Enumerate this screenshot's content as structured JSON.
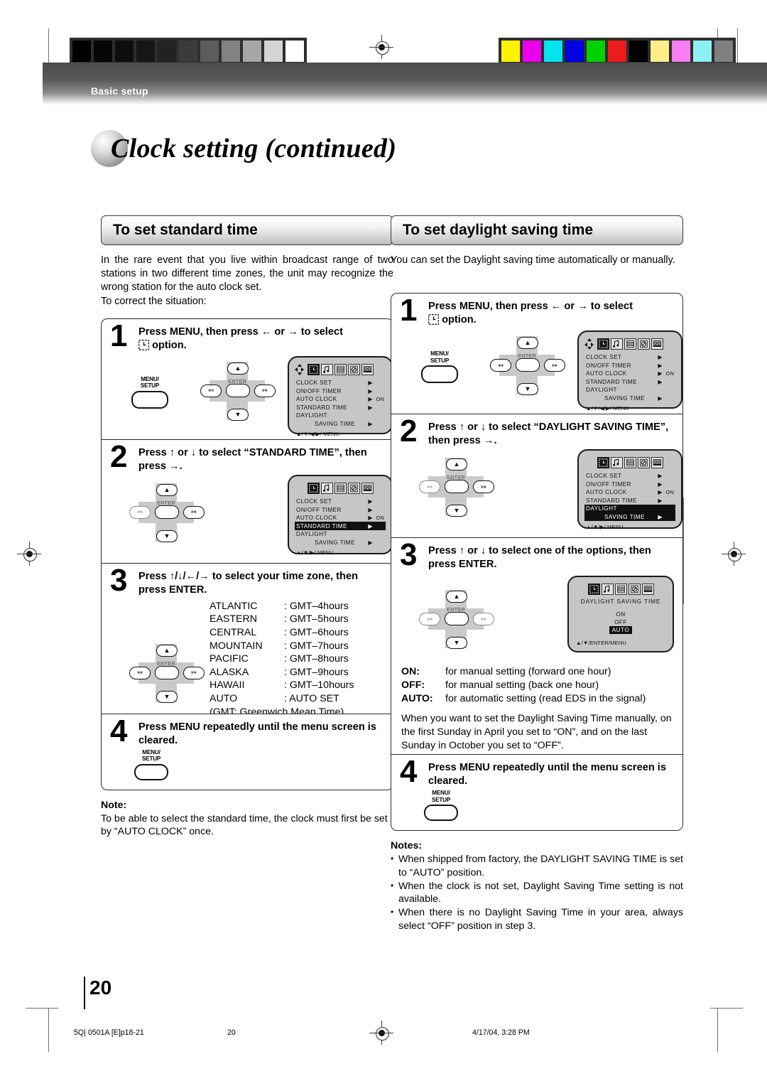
{
  "header": {
    "band_label": "Basic setup"
  },
  "title": {
    "text": "Clock setting (continued)"
  },
  "left_column": {
    "heading": "To set standard time",
    "intro": "In the rare event that you live within broadcast range of two stations in two different time zones, the unit may recognize the wrong station for the auto clock set.",
    "intro2": "To correct the situation:",
    "steps": [
      {
        "num": "1",
        "title_a": "Press MENU, then press",
        "arrow_left": "←",
        "or": "or",
        "arrow_right": "→",
        "title_b": "to select",
        "title_c": "option.",
        "menu_button": "MENU/\nSETUP"
      },
      {
        "num": "2",
        "title": "Press ↑ or ↓ to select “STANDARD TIME”, then press →."
      },
      {
        "num": "3",
        "title": "Press ↑/↓/←/→ to select your time zone, then press ENTER."
      },
      {
        "num": "4",
        "title": "Press MENU repeatedly until the menu screen is cleared.",
        "menu_button": "MENU/\nSETUP"
      }
    ],
    "timezones": [
      {
        "zone": "ATLANTIC",
        "value": ": GMT–4hours"
      },
      {
        "zone": "EASTERN",
        "value": ": GMT–5hours"
      },
      {
        "zone": "CENTRAL",
        "value": ": GMT–6hours"
      },
      {
        "zone": "MOUNTAIN",
        "value": ": GMT–7hours"
      },
      {
        "zone": "PACIFIC",
        "value": ": GMT–8hours"
      },
      {
        "zone": "ALASKA",
        "value": ": GMT–9hours"
      },
      {
        "zone": "HAWAII",
        "value": ": GMT–10hours"
      },
      {
        "zone": "AUTO",
        "value": ": AUTO SET"
      }
    ],
    "gmt_note": "(GMT: Greenwich Mean Time)",
    "note": {
      "heading": "Note:",
      "body": "To be able to select the standard time, the clock must first be set by “AUTO CLOCK” once."
    }
  },
  "right_column": {
    "heading": "To set daylight saving time",
    "intro": "You can set the Daylight saving time automatically or manually.",
    "steps": [
      {
        "num": "1",
        "title_a": "Press MENU, then press",
        "arrow_left": "←",
        "or": "or",
        "arrow_right": "→",
        "title_b": "to select",
        "title_c": "option.",
        "menu_button": "MENU/\nSETUP"
      },
      {
        "num": "2",
        "title": "Press ↑ or ↓ to select “DAYLIGHT SAVING TIME”, then press →."
      },
      {
        "num": "3",
        "title": "Press ↑ or ↓ to select one of the options, then press ENTER."
      },
      {
        "num": "4",
        "title": "Press MENU repeatedly until the menu screen is cleared.",
        "menu_button": "MENU/\nSETUP"
      }
    ],
    "option_defs": [
      {
        "key": "ON:",
        "desc": "for manual setting (forward one hour)"
      },
      {
        "key": "OFF:",
        "desc": "for manual setting (back one hour)"
      },
      {
        "key": "AUTO:",
        "desc": "for automatic setting (read EDS in the signal)"
      }
    ],
    "manual_para": "When you want to set the Daylight Saving Time manually, on the first Sunday in April you set to “ON”, and on the last Sunday in October you set to “OFF”.",
    "notes": {
      "heading": "Notes:",
      "items": [
        "When shipped from factory, the DAYLIGHT SAVING TIME is set to “AUTO” position.",
        "When the clock is not set, Daylight Saving Time setting is not available.",
        "When there is no Daylight Saving Time in your area, always select “OFF” position in step 3."
      ]
    }
  },
  "osd": {
    "menu_items": [
      {
        "label": "CLOCK  SET",
        "arrow": "▶",
        "value": ""
      },
      {
        "label": "ON/OFF  TIMER",
        "arrow": "▶",
        "value": ""
      },
      {
        "label": "AUTO  CLOCK",
        "arrow": "▶",
        "value": "ON"
      },
      {
        "label": "STANDARD  TIME",
        "arrow": "▶",
        "value": ""
      },
      {
        "label": "DAYLIGHT",
        "arrow": "",
        "value": ""
      },
      {
        "label": "SAVING  TIME",
        "arrow": "▶",
        "value": ""
      }
    ],
    "foot_full": "▲/▼/◀/▶/ MENU",
    "foot_short": "▲/▼/▶/ MENU",
    "foot_enter": "▲/▼/ENTER/MENU",
    "dst_title": "DAYLIGHT  SAVING  TIME",
    "dst_options": [
      "ON",
      "OFF",
      "AUTO"
    ],
    "dst_selected": "AUTO",
    "enter_label": "ENTER"
  },
  "footer": {
    "page_number": "20",
    "job_code": "5Q| 0501A [E]p18-21",
    "page_mark": "20",
    "timestamp": "4/17/04, 3:28 PM"
  },
  "colors": {
    "gray_wedge": [
      "#000000",
      "#060606",
      "#0d0d0d",
      "#161616",
      "#222222",
      "#3b3b3b",
      "#5c5c5c",
      "#828282",
      "#a6a6a6",
      "#d4d4d4",
      "#ffffff"
    ],
    "color_bars": [
      "#fff200",
      "#ec00ec",
      "#00e5f0",
      "#0000e0",
      "#00d200",
      "#ed1b1b",
      "#000000",
      "#fdee8a",
      "#f87ef3",
      "#8ef0f5",
      "#808080"
    ]
  }
}
